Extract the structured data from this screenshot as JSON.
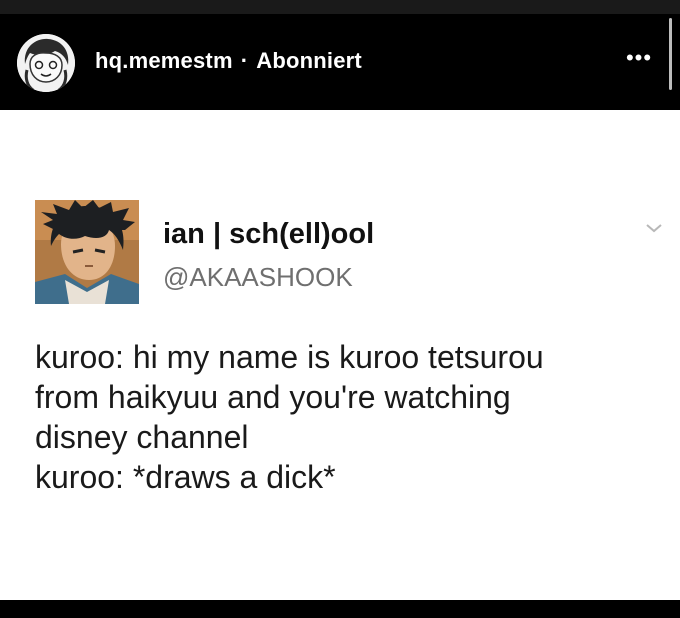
{
  "header": {
    "username": "hq.memestm",
    "separator": "·",
    "follow_status": "Abonniert",
    "more_label": "•••"
  },
  "tweet": {
    "display_name": "ian | sch(ell)ool",
    "handle": "@AKAASHOOK",
    "lines": [
      "kuroo: hi my name is kuroo tetsurou",
      "from haikyuu and you're watching",
      "disney channel",
      "kuroo: *draws a dick*"
    ]
  },
  "colors": {
    "header_bg": "#000000",
    "header_text": "#ffffff",
    "content_bg": "#ffffff",
    "handle_text": "#6f6f6f"
  }
}
